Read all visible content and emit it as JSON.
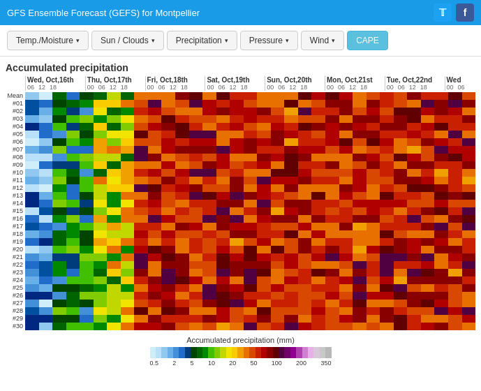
{
  "header": {
    "title": "GFS Ensemble Forecast (GEFS) for Montpellier",
    "twitter_label": "t",
    "facebook_label": "f"
  },
  "nav": {
    "items": [
      {
        "label": "Temp./Moisture",
        "caret": true,
        "active": false
      },
      {
        "label": "Sun / Clouds",
        "caret": true,
        "active": false
      },
      {
        "label": "Precipitation",
        "caret": true,
        "active": false
      },
      {
        "label": "Pressure",
        "caret": true,
        "active": false
      },
      {
        "label": "Wind",
        "caret": true,
        "active": false
      },
      {
        "label": "CAPE",
        "caret": false,
        "active": true
      }
    ]
  },
  "main": {
    "section_title": "Accumulated precipitation",
    "dates": [
      {
        "label": "Wed, Oct,16th",
        "ticks": [
          "06",
          "12",
          "18"
        ]
      },
      {
        "label": "Thu, Oct,17th",
        "ticks": [
          "00",
          "06",
          "12",
          "18"
        ]
      },
      {
        "label": "Fri, Oct,18th",
        "ticks": [
          "00",
          "06",
          "12",
          "18"
        ]
      },
      {
        "label": "Sat, Oct,19th",
        "ticks": [
          "00",
          "06",
          "12",
          "18"
        ]
      },
      {
        "label": "Sun, Oct,20th",
        "ticks": [
          "00",
          "06",
          "12",
          "18"
        ]
      },
      {
        "label": "Mon, Oct,21st",
        "ticks": [
          "00",
          "06",
          "12",
          "18"
        ]
      },
      {
        "label": "Tue, Oct,22nd",
        "ticks": [
          "00",
          "06",
          "12",
          "18"
        ]
      },
      {
        "label": "Wed",
        "ticks": [
          "00",
          "06"
        ]
      }
    ],
    "row_labels": [
      "Mean",
      "#01",
      "#02",
      "#03",
      "#04",
      "#05",
      "#06",
      "#07",
      "#08",
      "#09",
      "#10",
      "#11",
      "#12",
      "#13",
      "#14",
      "#15",
      "#16",
      "#17",
      "#18",
      "#19",
      "#20",
      "#21",
      "#22",
      "#23",
      "#24",
      "#25",
      "#26",
      "#27",
      "#28",
      "#29",
      "#30"
    ],
    "legend": {
      "title": "Accumulated precipitation (mm)",
      "labels": [
        "0.5",
        "2",
        "5",
        "10",
        "20",
        "50",
        "100",
        "200",
        "350"
      ],
      "colors": [
        "#c8e6fa",
        "#a0ccf0",
        "#78b0e8",
        "#5090d8",
        "#1060c0",
        "#006400",
        "#00a000",
        "#c8d400",
        "#f0f000",
        "#f0c000",
        "#e08000",
        "#d04000",
        "#c00000",
        "#900000",
        "#600060",
        "#a000a0",
        "#d060d0",
        "#e0a0e0",
        "#d8c8d8",
        "#c0c0c0",
        "#a8a8a8"
      ]
    }
  }
}
